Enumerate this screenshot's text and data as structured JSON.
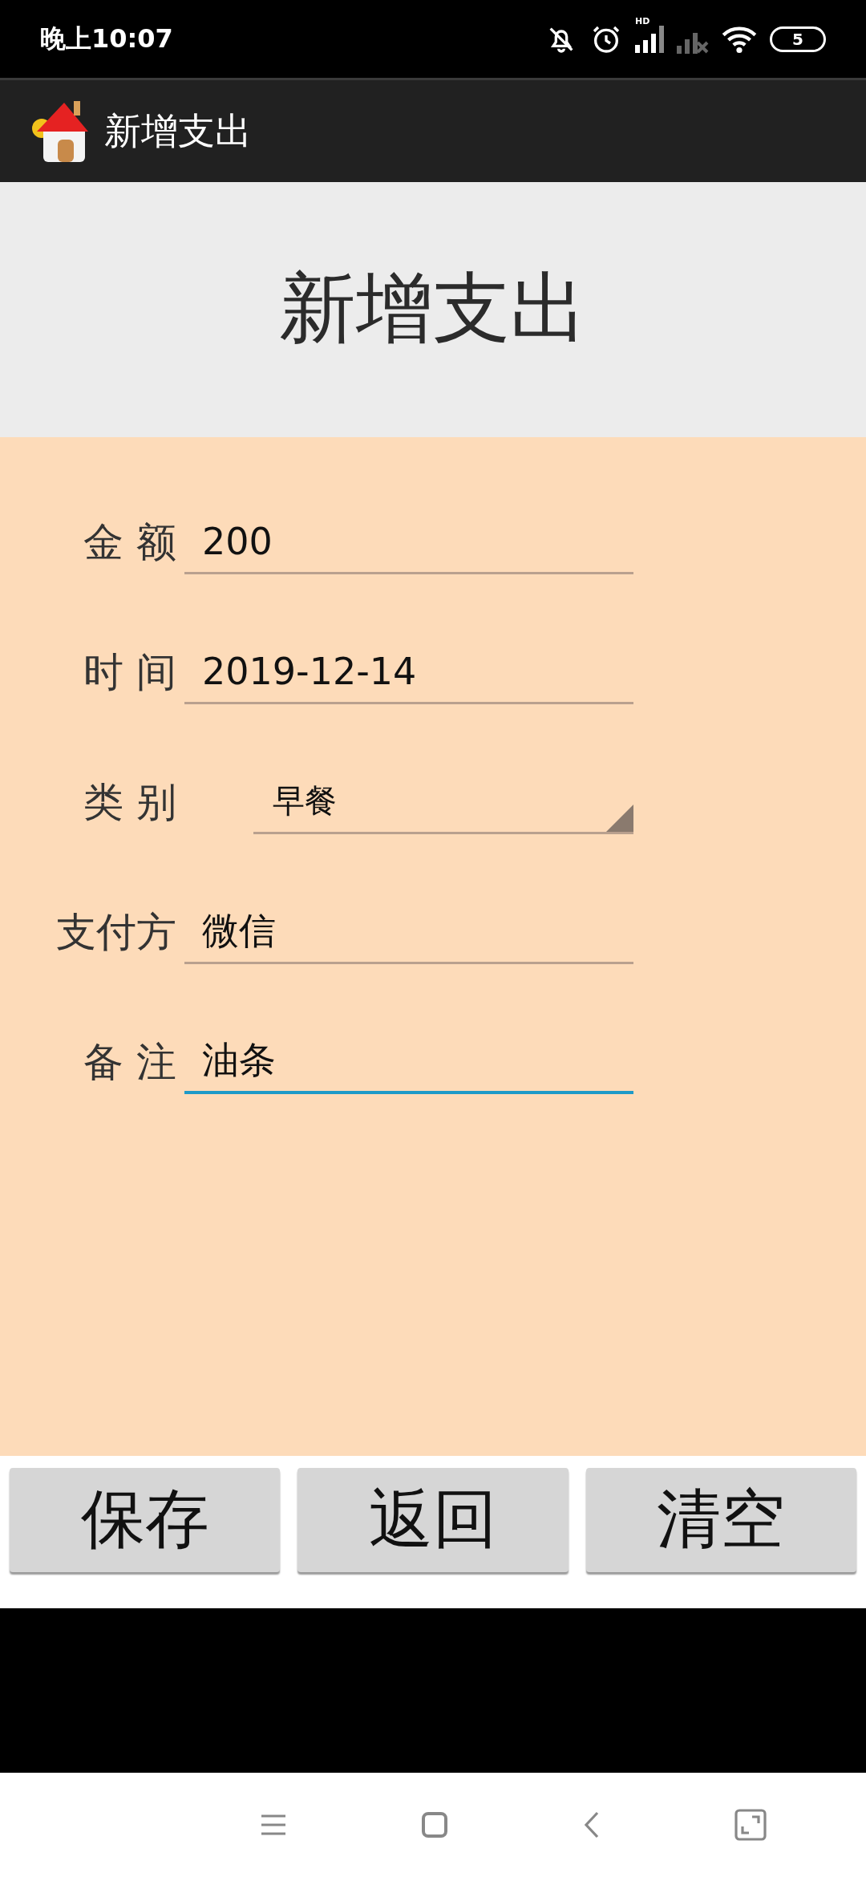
{
  "status_bar": {
    "time": "晚上10:07",
    "network_label": "HD",
    "battery": "5"
  },
  "app_bar": {
    "title": "新增支出"
  },
  "header": {
    "title": "新增支出"
  },
  "form": {
    "fields": [
      {
        "label": "金 额",
        "kind": "text",
        "value": "200",
        "focused": false
      },
      {
        "label": "时 间",
        "kind": "text",
        "value": "2019-12-14",
        "focused": false
      },
      {
        "label": "类 别",
        "kind": "spinner",
        "value": "早餐",
        "focused": false
      },
      {
        "label": "支付方",
        "kind": "text",
        "value": "微信",
        "focused": false
      },
      {
        "label": "备 注",
        "kind": "text",
        "value": "油条",
        "focused": true
      }
    ]
  },
  "buttons": [
    "保存",
    "返回",
    "清空"
  ]
}
